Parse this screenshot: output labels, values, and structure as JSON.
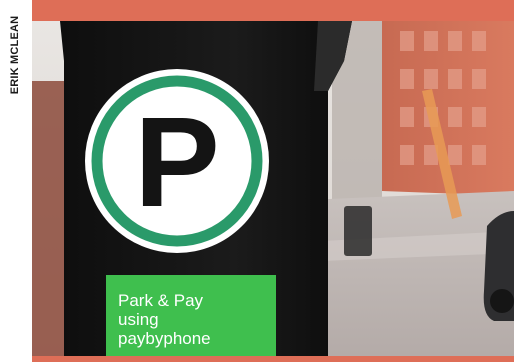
{
  "photo_credit": "ERIK MCLEAN",
  "sign": {
    "letter": "P",
    "lines": [
      "Park & Pay",
      "using",
      "paybyphone"
    ]
  },
  "colors": {
    "accent_bar": "#de6e57",
    "sign_green": "#2a9a6a",
    "sticker_green": "#3fbf4e",
    "post_black": "#141414"
  }
}
